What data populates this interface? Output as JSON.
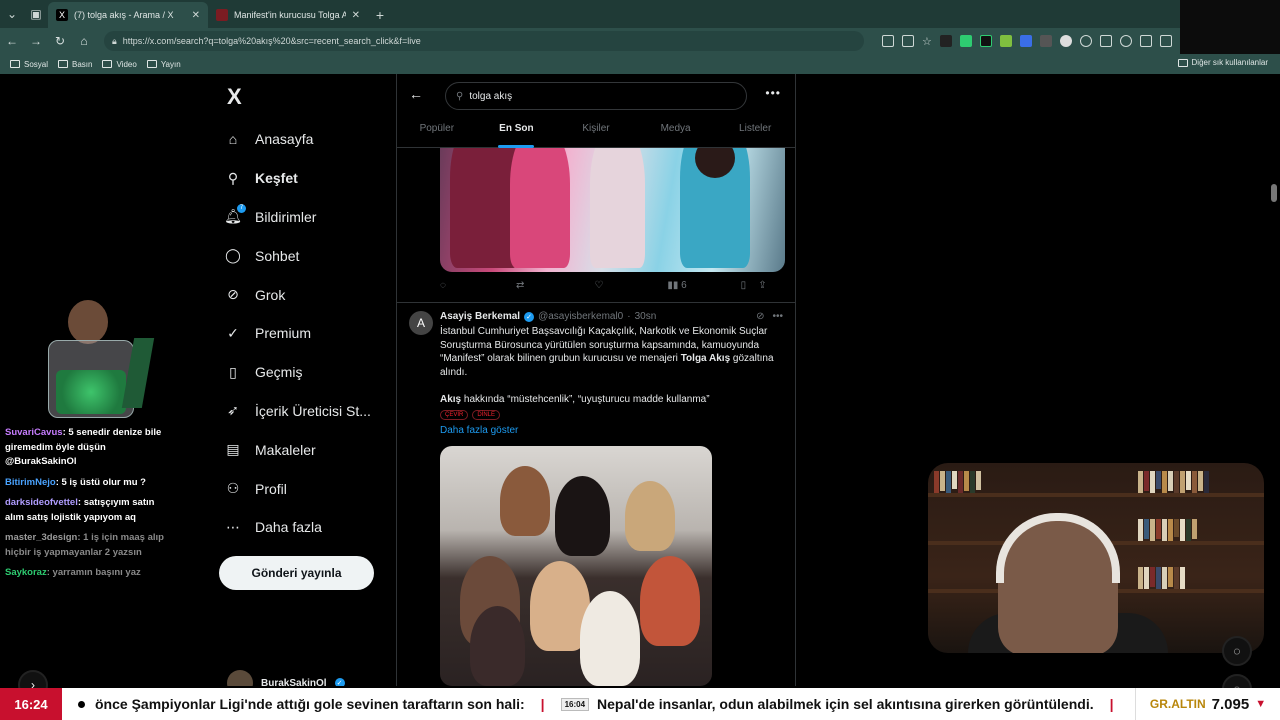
{
  "browser": {
    "tabs": [
      {
        "title": "(7) tolga akış - Arama / X",
        "favicon": "X"
      },
      {
        "title": "Manifest'in kurucusu Tolga Akış gö",
        "favicon": ""
      }
    ],
    "url": "https://x.com/search?q=tolga%20akış%20&src=recent_search_click&f=live",
    "bookmarks": [
      "Sosyal",
      "Basın",
      "Video",
      "Yayın"
    ],
    "other_bookmarks": "Diğer sık kullanılanlar"
  },
  "x": {
    "logo": "X",
    "nav": [
      {
        "label": "Anasayfa",
        "icon": "home-icon",
        "glyph": "⌂"
      },
      {
        "label": "Keşfet",
        "icon": "search-icon",
        "glyph": "⚲",
        "bold": true
      },
      {
        "label": "Bildirimler",
        "icon": "bell-icon",
        "glyph": "🔔︎",
        "badge": "7"
      },
      {
        "label": "Sohbet",
        "icon": "chat-icon",
        "glyph": "◯"
      },
      {
        "label": "Grok",
        "icon": "grok-icon",
        "glyph": "⊘"
      },
      {
        "label": "Premium",
        "icon": "premium-icon",
        "glyph": "✓"
      },
      {
        "label": "Geçmiş",
        "icon": "bookmark-icon",
        "glyph": "▯"
      },
      {
        "label": "İçerik Üreticisi St...",
        "icon": "rocket-icon",
        "glyph": "➶"
      },
      {
        "label": "Makaleler",
        "icon": "article-icon",
        "glyph": "▤"
      },
      {
        "label": "Profil",
        "icon": "profile-icon",
        "glyph": "⚇"
      },
      {
        "label": "Daha fazla",
        "icon": "more-icon",
        "glyph": "⋯"
      }
    ],
    "post_button": "Gönderi yayınla",
    "account_name": "BurakSakinOl",
    "search_value": "tolga akış",
    "search_tabs": [
      "Popüler",
      "En Son",
      "Kişiler",
      "Medya",
      "Listeler"
    ],
    "active_tab": "En Son",
    "prev_tweet_views": "6",
    "tweet": {
      "name": "Asayiş Berkemal",
      "handle": "@asayisberkemal0",
      "time": "30sn",
      "text_part1": "İstanbul Cumhuriyet Başsavcılığı Kaçakçılık, Narkotik ve Ekonomik Suçlar Soruşturma Bürosunca yürütülen soruşturma kapsamında, kamuoyunda “Manifest” olarak bilinen grubun kurucusu ve menajeri ",
      "text_bold": "Tolga Akış",
      "text_part2": " gözaltına alındı.",
      "text2_bold": "Akış",
      "text2_rest": " hakkında “müstehcenlik”, “uyuşturucu madde kullanma”",
      "chip1": "ÇEVİR",
      "chip2": "DİNLE",
      "show_more": "Daha fazla göster"
    }
  },
  "stream": {
    "chat": [
      {
        "user": "SuvariCavus",
        "msg": "5 senedir denize bile giremedim öyle düşün @BurakSakinOl"
      },
      {
        "user": "BitirimNejo",
        "msg": "5 iş üstü olur mu ?"
      },
      {
        "user": "darksideofvettel",
        "msg": "satışçıyım satın alım satış lojistik yapıyom aq"
      },
      {
        "user": "master_3design",
        "msg": "1 iş için maaş alıp hiçbir iş yapmayanlar 2 yazsın"
      },
      {
        "user": "Saykoraz",
        "msg": "yarramın başını yaz"
      }
    ],
    "ticker": {
      "clock": "16:24",
      "item1": "önce Şampiyonlar Ligi'nde attığı gole sevinen taraftarın son hali:",
      "item2_time": "16:04",
      "item2": "Nepal'de insanlar, odun alabilmek için sel akıntısına girerken görüntülendi.",
      "gold_label": "GR.ALTIN",
      "gold_value": "7.095"
    }
  },
  "colors": {
    "accent": "#1d9bf0",
    "ticker_red": "#c8102e",
    "browser": "#2d4f4a"
  }
}
